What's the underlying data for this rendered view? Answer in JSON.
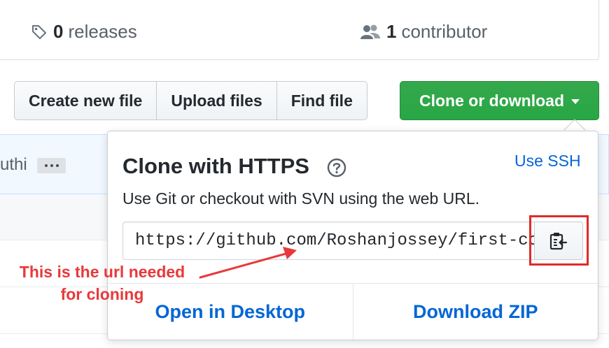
{
  "stats": {
    "releases_count": "0",
    "releases_label": "releases",
    "contributors_count": "1",
    "contributors_label": "contributor"
  },
  "file_actions": {
    "create_new_file": "Create new file",
    "upload_files": "Upload files",
    "find_file": "Find file",
    "clone_or_download": "Clone or download"
  },
  "commit": {
    "author_fragment": "uthi"
  },
  "clone_popover": {
    "title": "Clone with HTTPS",
    "use_ssh": "Use SSH",
    "description": "Use Git or checkout with SVN using the web URL.",
    "url": "https://github.com/Roshanjossey/first-contributions.git",
    "open_in_desktop": "Open in Desktop",
    "download_zip": "Download ZIP"
  },
  "annotation": {
    "text": "This is the url needed for cloning",
    "color": "#e8393a"
  },
  "colors": {
    "clone_button": "#28a745",
    "link": "#0366d6",
    "highlight": "#e02a2a"
  },
  "icons": [
    "tag-icon",
    "people-icon",
    "question-icon",
    "clipboard-icon",
    "caret-down-icon"
  ]
}
